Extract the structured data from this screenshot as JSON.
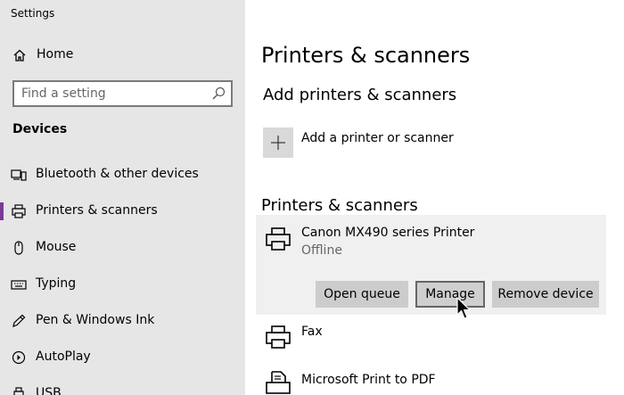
{
  "window": {
    "title": "Settings"
  },
  "sidebar": {
    "home_label": "Home",
    "search_placeholder": "Find a setting",
    "section_label": "Devices",
    "items": [
      {
        "label": "Bluetooth & other devices",
        "icon": "bluetooth-devices-icon",
        "active": false
      },
      {
        "label": "Printers & scanners",
        "icon": "printer-icon",
        "active": true
      },
      {
        "label": "Mouse",
        "icon": "mouse-icon",
        "active": false
      },
      {
        "label": "Typing",
        "icon": "keyboard-icon",
        "active": false
      },
      {
        "label": "Pen & Windows Ink",
        "icon": "pen-icon",
        "active": false
      },
      {
        "label": "AutoPlay",
        "icon": "autoplay-icon",
        "active": false
      },
      {
        "label": "USB",
        "icon": "usb-icon",
        "active": false
      }
    ]
  },
  "main": {
    "page_title": "Printers & scanners",
    "add_section_title": "Add printers & scanners",
    "add_label": "Add a printer or scanner",
    "list_section_title": "Printers & scanners",
    "printers": [
      {
        "name": "Canon MX490 series Printer",
        "status": "Offline",
        "expanded": true
      },
      {
        "name": "Fax",
        "status": "",
        "expanded": false
      },
      {
        "name": "Microsoft Print to PDF",
        "status": "",
        "expanded": false
      }
    ],
    "actions": {
      "open_queue": "Open queue",
      "manage": "Manage",
      "remove_device": "Remove device"
    }
  },
  "colors": {
    "sidebar_bg": "#e6e6e6",
    "accent": "#7a3a9a",
    "selected_row_bg": "#f0f0f0",
    "button_bg": "#cccccc"
  }
}
